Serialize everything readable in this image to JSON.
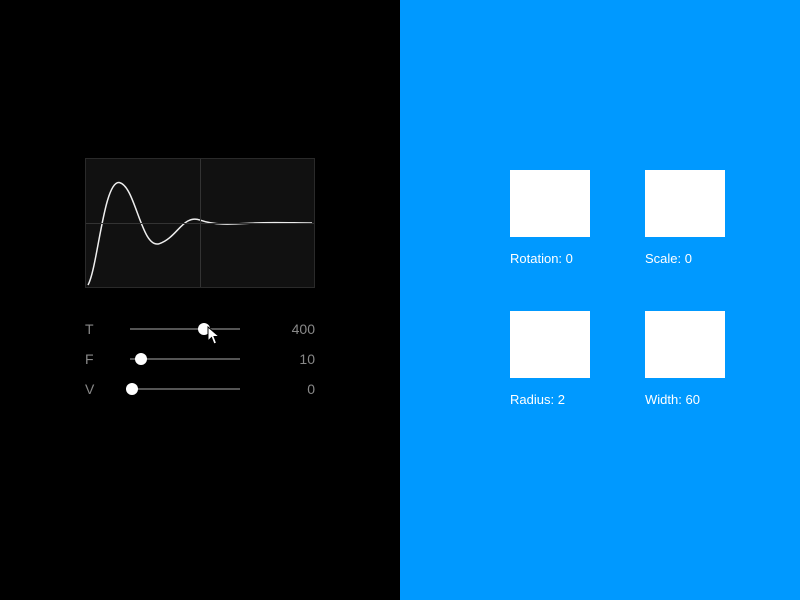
{
  "colors": {
    "left_bg": "#000000",
    "right_bg": "#0099ff",
    "swatch": "#ffffff"
  },
  "sliders": [
    {
      "label": "T",
      "value": "400",
      "pos": 0.67
    },
    {
      "label": "F",
      "value": "10",
      "pos": 0.1
    },
    {
      "label": "V",
      "value": "0",
      "pos": 0.02
    }
  ],
  "tiles": [
    {
      "key": "rotation",
      "label_prefix": "Rotation:",
      "value": "0"
    },
    {
      "key": "scale",
      "label_prefix": "Scale:",
      "value": "0"
    },
    {
      "key": "radius",
      "label_prefix": "Radius:",
      "value": "2"
    },
    {
      "key": "width",
      "label_prefix": "Width:",
      "value": "60"
    }
  ]
}
